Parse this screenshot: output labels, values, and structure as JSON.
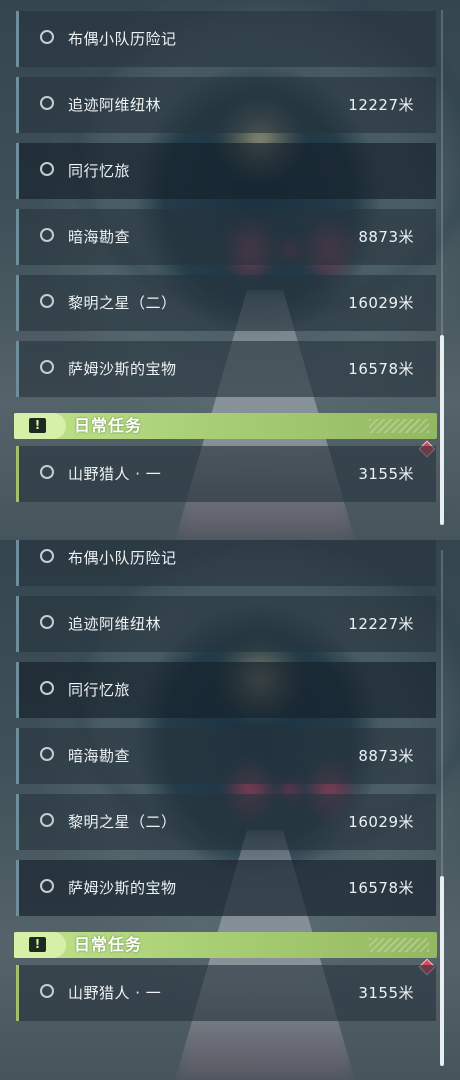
{
  "quest_list": {
    "items": [
      {
        "name": "布偶小队历险记",
        "distance": ""
      },
      {
        "name": "追迹阿维纽林",
        "distance": "12227米"
      },
      {
        "name": "同行忆旅",
        "distance": ""
      },
      {
        "name": "暗海勘查",
        "distance": "8873米"
      },
      {
        "name": "黎明之星（二）",
        "distance": "16029米"
      },
      {
        "name": "萨姆沙斯的宝物",
        "distance": "16578米"
      }
    ],
    "daily_header": {
      "icon": "exclamation-icon",
      "badge_glyph": "!",
      "title": "日常任务"
    },
    "daily_items": [
      {
        "name": "山野猎人 · 一",
        "distance": "3155米"
      }
    ]
  },
  "colors": {
    "daily_accent": "#a9cf76",
    "quest_accent": "#6d8e9a",
    "tracked_marker": "#d9475a"
  }
}
